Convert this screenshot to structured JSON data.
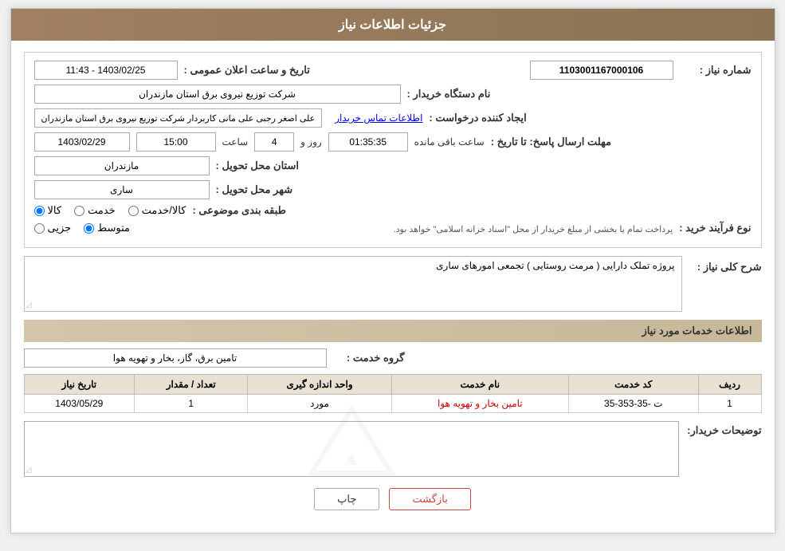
{
  "header": {
    "title": "جزئیات اطلاعات نیاز"
  },
  "info": {
    "shomareNiaz_label": "شماره نیاز :",
    "shomareNiaz_value": "1103001167000106",
    "namDastgah_label": "نام دستگاه خریدار :",
    "namDastgah_value": "شرکت توزیع نیروی برق استان مازندران",
    "tarikh_label": "تاریخ و ساعت اعلان عمومی :",
    "tarikh_value": "1403/02/25 - 11:43",
    "ijadKonnande_label": "ایجاد کننده درخواست :",
    "ijadKonnande_value": "علی اصغر رجبی علی مانی کاربردار شرکت توزیع نیروی برق استان مازندران",
    "ijadKonnande_link": "اطلاعات تماس خریدار",
    "mohlatErsal_label": "مهلت ارسال پاسخ: تا تاریخ :",
    "date_value": "1403/02/29",
    "saatLabel": "ساعت",
    "saat_value": "15:00",
    "roozLabel": "روز و",
    "rooz_value": "4",
    "mandeLabel": "ساعت باقی مانده",
    "mande_value": "01:35:35",
    "ostan_label": "استان محل تحویل :",
    "ostan_value": "مازندران",
    "shahr_label": "شهر محل تحویل :",
    "shahr_value": "ساری",
    "tabaqe_label": "طبقه بندی موضوعی :",
    "tabaqe_options": [
      {
        "label": "کالا",
        "value": "kala",
        "checked": true
      },
      {
        "label": "خدمت",
        "value": "khedmat",
        "checked": false
      },
      {
        "label": "کالا/خدمت",
        "value": "kala_khedmat",
        "checked": false
      }
    ],
    "noFarayand_label": "نوع فرآیند خرید :",
    "noFarayand_options": [
      {
        "label": "جزیی",
        "value": "jozii",
        "checked": false
      },
      {
        "label": "متوسط",
        "value": "motavasset",
        "checked": true
      }
    ],
    "noFarayand_note": "پرداخت تمام یا بخشی از مبلغ خریدار از محل \"اسناد خزانه اسلامی\" خواهد بود.",
    "sharhKoli_label": "شرح کلی نیاز :",
    "sharhKoli_value": "پروژه تملک دارایی ( مرمت روستایی ) تجمعی امورهای ساری"
  },
  "services": {
    "section_title": "اطلاعات خدمات مورد نیاز",
    "groheKhedmat_label": "گروه خدمت :",
    "groheKhedmat_value": "تامین برق، گاز، بخار و تهویه هوا",
    "table": {
      "headers": [
        "ردیف",
        "کد خدمت",
        "نام خدمت",
        "واحد اندازه گیری",
        "تعداد / مقدار",
        "تاریخ نیاز"
      ],
      "rows": [
        {
          "radif": "1",
          "kodKhedmat": "ت -35-353-35",
          "namKhedmat": "تامین بخار و تهویه هوا",
          "vahed": "مورد",
          "tedad": "1",
          "tarikh": "1403/05/29"
        }
      ]
    }
  },
  "buyerDesc": {
    "label": "توضیحات خریدار:",
    "value": ""
  },
  "buttons": {
    "print": "چاپ",
    "back": "بازگشت"
  }
}
